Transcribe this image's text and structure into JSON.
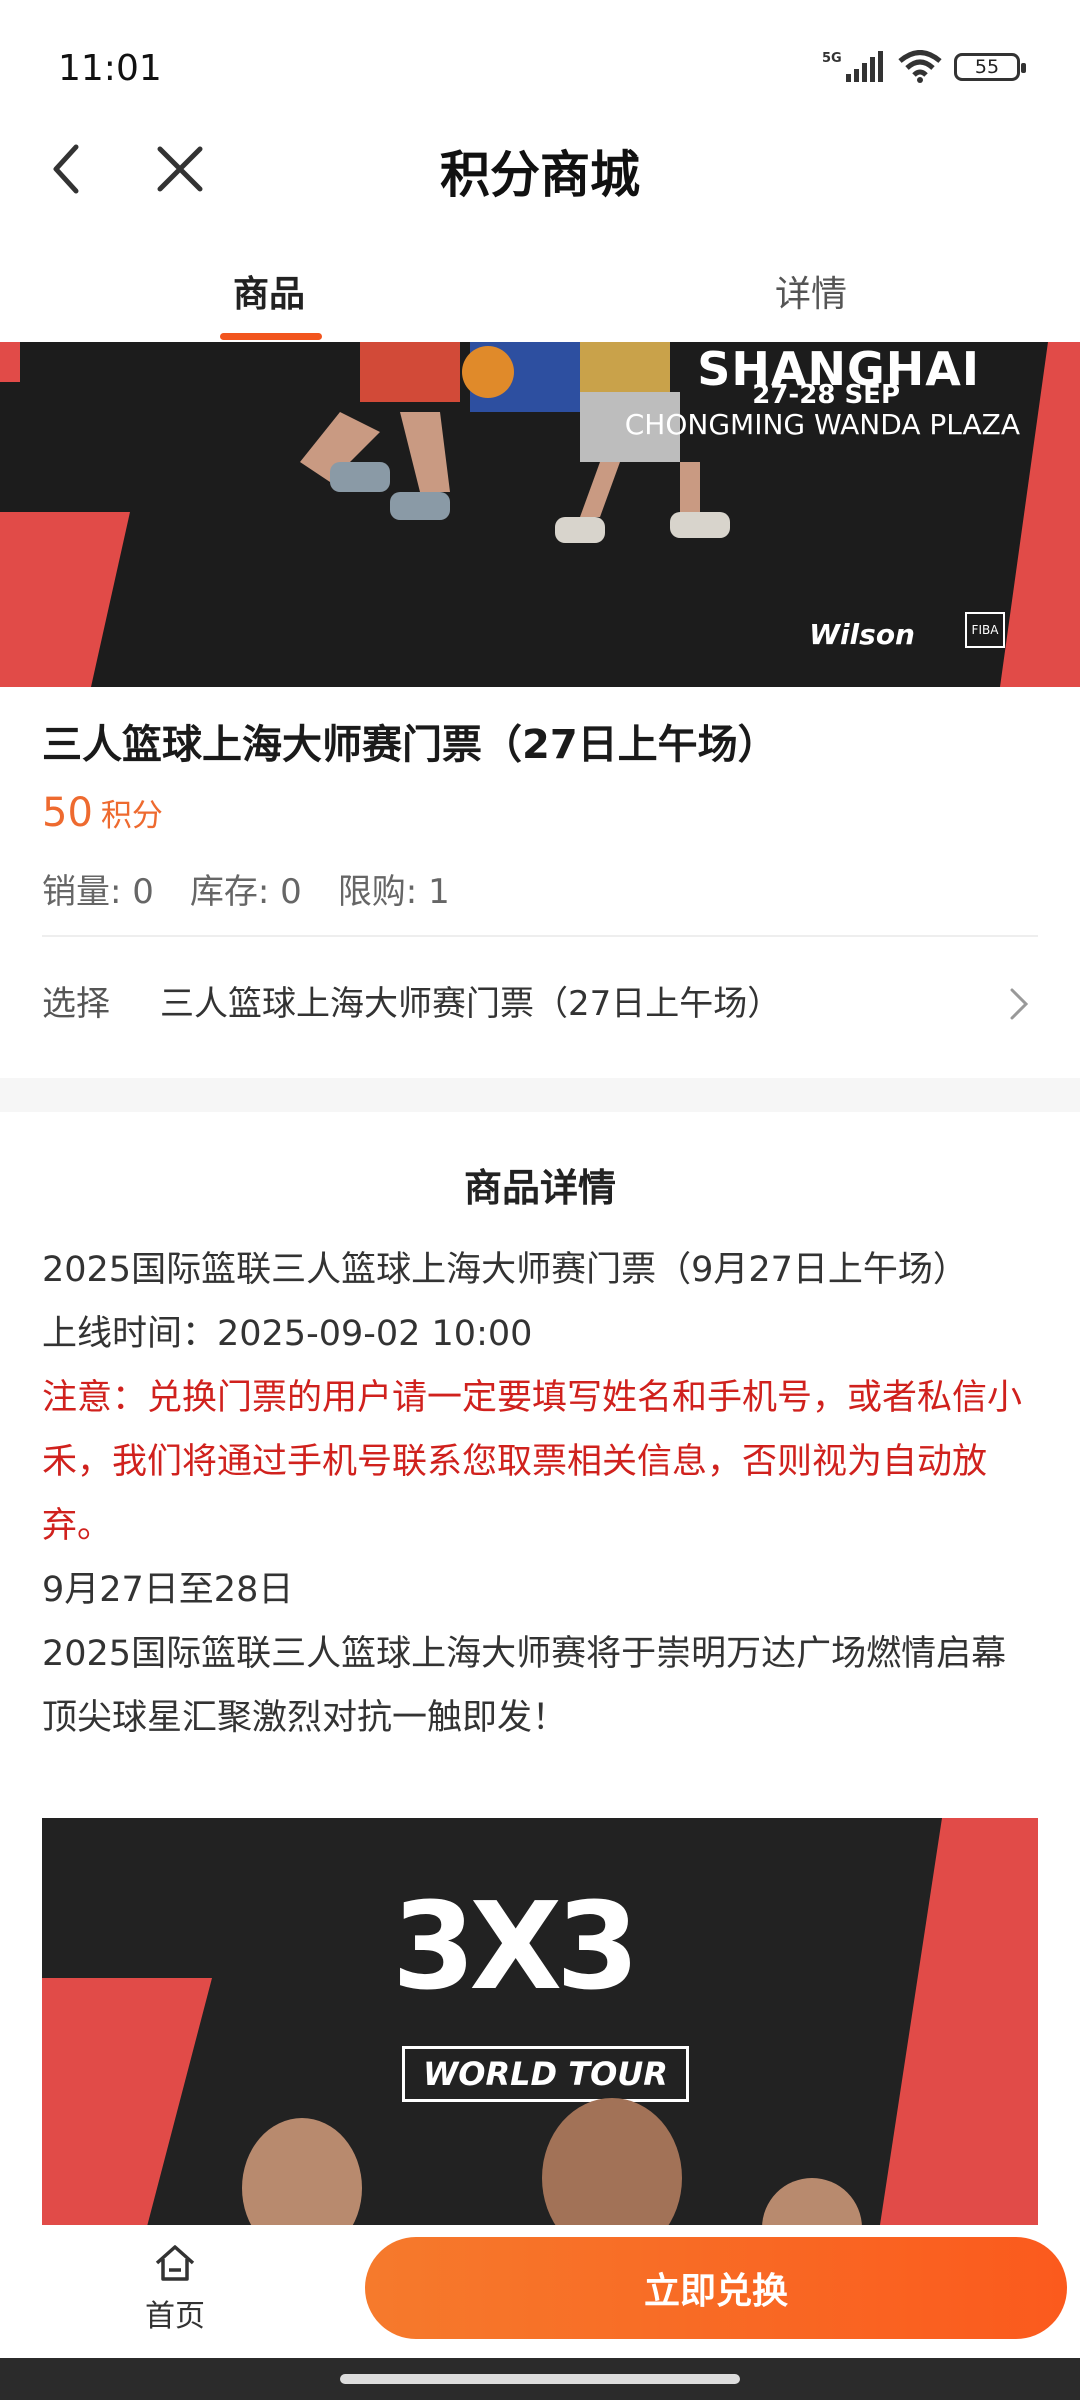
{
  "status_bar": {
    "time": "11:01",
    "network": "5G",
    "battery": "55"
  },
  "nav": {
    "title": "积分商城",
    "back_icon": "back-arrow-icon",
    "close_icon": "close-icon"
  },
  "tabs": [
    {
      "label": "商品",
      "active": true
    },
    {
      "label": "详情",
      "active": false
    }
  ],
  "banner": {
    "city": "SHANGHAI",
    "dates": "27-28 SEP",
    "venue": "CHONGMING WANDA PLAZA",
    "sponsor": "Wilson",
    "org": "FIBA"
  },
  "product": {
    "title": "三人篮球上海大师赛门票（27日上午场）",
    "price_value": "50",
    "price_unit": "积分",
    "sales": "销量: 0",
    "stock": "库存: 0",
    "limit": "限购: 1",
    "select_label": "选择",
    "select_value": "三人篮球上海大师赛门票（27日上午场）"
  },
  "details": {
    "heading": "商品详情",
    "line1": "2025国际篮联三人篮球上海大师赛门票（9月27日上午场）",
    "line2": "上线时间：2025-09-02 10:00",
    "notice": "注意：兑换门票的用户请一定要填写姓名和手机号，或者私信小禾，我们将通过手机号联系您取票相关信息，否则视为自动放弃。",
    "line4": "9月27日至28日",
    "line5": "2025国际篮联三人篮球上海大师赛将于崇明万达广场燃情启幕",
    "line6": "顶尖球星汇聚激烈对抗一触即发！"
  },
  "poster": {
    "logo": "3X3",
    "subtitle": "WORLD TOUR"
  },
  "bottom": {
    "home_label": "首页",
    "exchange_label": "立即兑换"
  },
  "colors": {
    "accent": "#f2551e",
    "price": "#ee6a2f",
    "notice": "#d0211d",
    "banner_red": "#e14b48"
  }
}
